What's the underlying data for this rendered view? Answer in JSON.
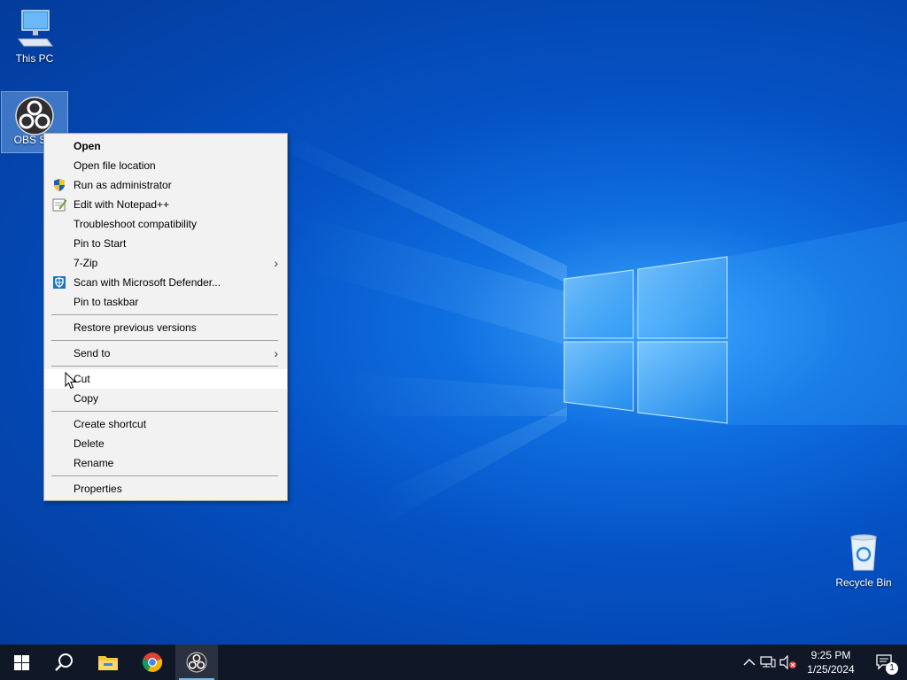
{
  "desktop": {
    "icons": [
      {
        "label": "This PC"
      },
      {
        "label": "OBS Stu"
      },
      {
        "label": "Recycle Bin"
      }
    ]
  },
  "context_menu": {
    "groups": [
      [
        {
          "label": "Open",
          "bold": true
        },
        {
          "label": "Open file location"
        },
        {
          "label": "Run as administrator",
          "icon": "shield-icon"
        },
        {
          "label": "Edit with Notepad++",
          "icon": "notepad-plus-plus-icon"
        },
        {
          "label": "Troubleshoot compatibility"
        },
        {
          "label": "Pin to Start"
        },
        {
          "label": "7-Zip",
          "submenu": true
        },
        {
          "label": "Scan with Microsoft Defender...",
          "icon": "defender-icon"
        },
        {
          "label": "Pin to taskbar"
        }
      ],
      [
        {
          "label": "Restore previous versions"
        }
      ],
      [
        {
          "label": "Send to",
          "submenu": true
        }
      ],
      [
        {
          "label": "Cut",
          "hover": true
        },
        {
          "label": "Copy"
        }
      ],
      [
        {
          "label": "Create shortcut"
        },
        {
          "label": "Delete"
        },
        {
          "label": "Rename"
        }
      ],
      [
        {
          "label": "Properties"
        }
      ]
    ]
  },
  "taskbar": {
    "apps": [
      "start-icon",
      "search-icon",
      "file-explorer-icon",
      "chrome-icon",
      "obs-studio-icon"
    ],
    "clock": {
      "time": "9:25 PM",
      "date": "1/25/2024"
    },
    "notification_count": "1"
  },
  "colors": {
    "accent": "#0a5bd0",
    "taskbar": "#101726",
    "menu_bg": "#f2f2f2"
  }
}
